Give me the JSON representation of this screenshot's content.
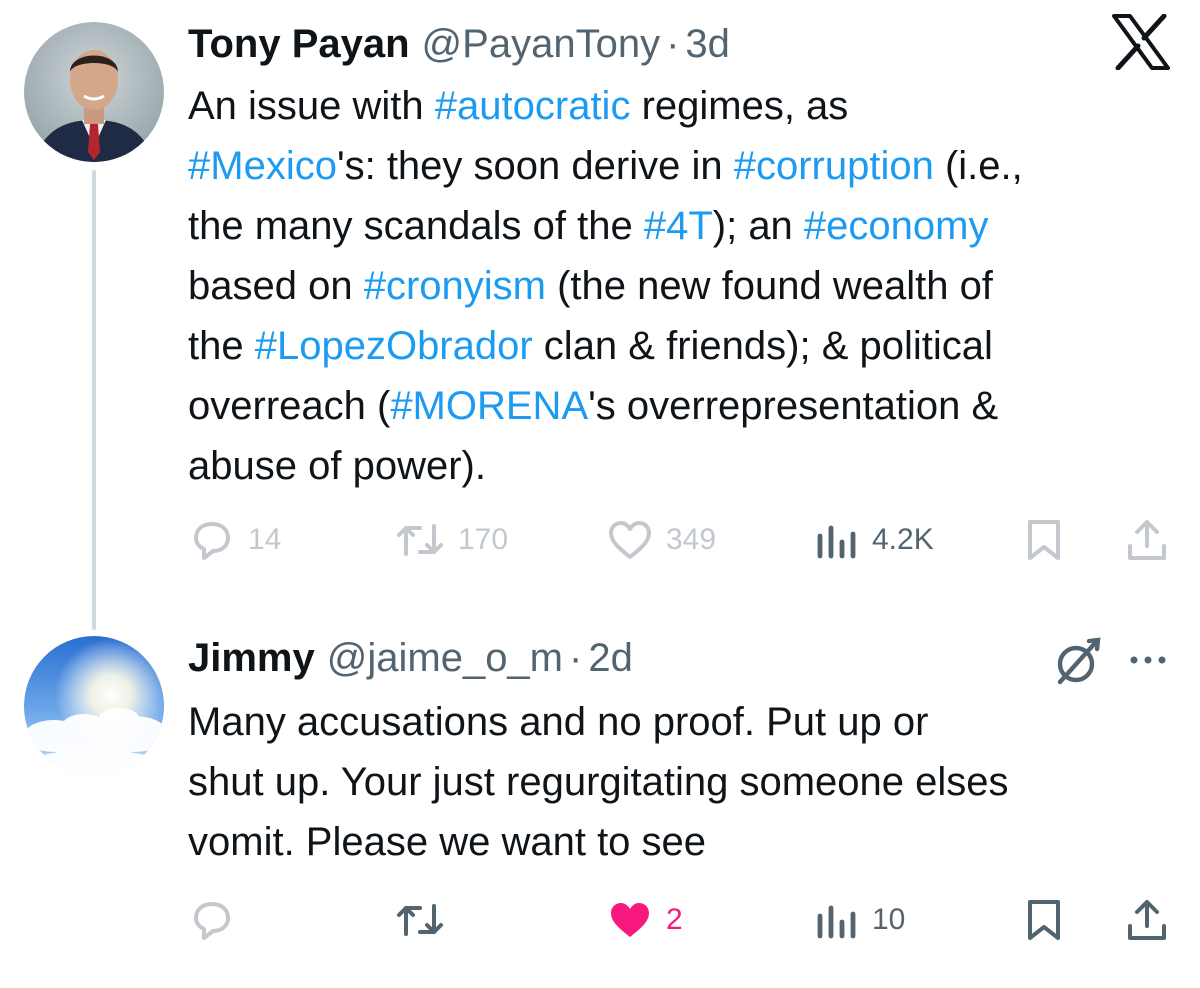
{
  "tweet": {
    "author_name": "Tony Payan",
    "handle": "@PayanTony",
    "separator": "·",
    "time": "3d",
    "brand_icon": "x-logo-icon",
    "lines": [
      [
        {
          "t": "An issue with "
        },
        {
          "t": "#autocratic",
          "tag": true
        },
        {
          "t": " regimes, as"
        }
      ],
      [
        {
          "t": "#Mexico",
          "tag": true
        },
        {
          "t": "'s: they soon derive in "
        },
        {
          "t": "#corruption",
          "tag": true
        },
        {
          "t": " (i.e.,"
        }
      ],
      [
        {
          "t": "the many scandals of the "
        },
        {
          "t": "#4T",
          "tag": true
        },
        {
          "t": "); an "
        },
        {
          "t": "#economy",
          "tag": true
        }
      ],
      [
        {
          "t": "based on "
        },
        {
          "t": "#cronyism",
          "tag": true
        },
        {
          "t": " (the new found wealth of"
        }
      ],
      [
        {
          "t": "the "
        },
        {
          "t": "#LopezObrador",
          "tag": true
        },
        {
          "t": " clan & friends); & political"
        }
      ],
      [
        {
          "t": "overreach ("
        },
        {
          "t": "#MORENA",
          "tag": true
        },
        {
          "t": "'s overrepresentation &"
        }
      ],
      [
        {
          "t": "abuse of power)."
        }
      ]
    ],
    "actions": {
      "replies": "14",
      "reposts": "170",
      "likes": "349",
      "views": "4.2K"
    }
  },
  "reply": {
    "author_name": "Jimmy",
    "handle": "@jaime_o_m",
    "separator": "·",
    "time": "2d",
    "status_icon": "mute-slash-icon",
    "menu_icon": "more-options-icon",
    "lines": [
      [
        {
          "t": "Many accusations and no proof. Put up or"
        }
      ],
      [
        {
          "t": "shut up. Your just regurgitating someone elses"
        }
      ],
      [
        {
          "t": "vomit. Please we want to see"
        }
      ]
    ],
    "actions": {
      "replies": "",
      "reposts": "",
      "likes": "2",
      "liked": true,
      "views": "10"
    }
  },
  "colors": {
    "text": "#0f1419",
    "secondary": "#536471",
    "hashtag": "#1d9bf0",
    "like": "#f91880",
    "thread_line": "#cfd9de"
  }
}
